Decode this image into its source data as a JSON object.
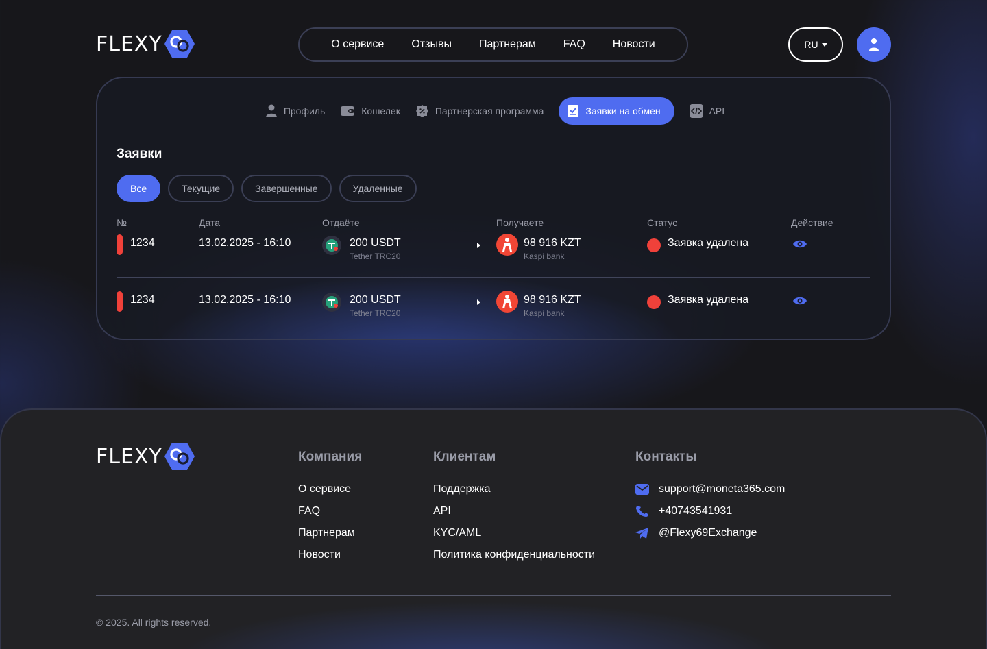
{
  "brand": {
    "name": "FLEXY"
  },
  "nav": {
    "items": [
      "О сервисе",
      "Отзывы",
      "Партнерам",
      "FAQ",
      "Новости"
    ]
  },
  "lang": {
    "value": "RU"
  },
  "account_tabs": [
    {
      "label": "Профиль",
      "icon": "user-icon"
    },
    {
      "label": "Кошелек",
      "icon": "wallet-icon"
    },
    {
      "label": "Партнерская программа",
      "icon": "percent-badge-icon"
    },
    {
      "label": "Заявки на обмен",
      "icon": "receipt-check-icon",
      "active": true
    },
    {
      "label": "API",
      "icon": "code-icon"
    }
  ],
  "orders": {
    "title": "Заявки",
    "filters": [
      "Все",
      "Текущие",
      "Завершенные",
      "Удаленные"
    ],
    "active_filter": "Все",
    "columns": [
      "№",
      "Дата",
      "Отдаёте",
      "Получаете",
      "Статус",
      "Действие"
    ],
    "rows": [
      {
        "id": "1234",
        "date": "13.02.2025 - 16:10",
        "give_amount": "200 USDT",
        "give_method": "Tether TRC20",
        "get_amount": "98 916 KZT",
        "get_method": "Kaspi bank",
        "status": "Заявка удалена"
      },
      {
        "id": "1234",
        "date": "13.02.2025 - 16:10",
        "give_amount": "200 USDT",
        "give_method": "Tether TRC20",
        "get_amount": "98 916 KZT",
        "get_method": "Kaspi bank",
        "status": "Заявка удалена"
      }
    ]
  },
  "footer": {
    "company": {
      "title": "Компания",
      "links": [
        "О сервисе",
        "FAQ",
        "Партнерам",
        "Новости"
      ]
    },
    "clients": {
      "title": "Клиентам",
      "links": [
        "Поддержка",
        "API",
        "KYC/AML",
        "Политика конфиденциальности"
      ]
    },
    "contacts": {
      "title": "Контакты",
      "email": "support@moneta365.com",
      "phone": "+40743541931",
      "telegram": "@Flexy69Exchange"
    },
    "copyright": "© 2025. All rights reserved."
  },
  "colors": {
    "accent": "#4f6cf0",
    "danger": "#f0413a",
    "tether": "#26a17b",
    "kaspi": "#f14635"
  }
}
